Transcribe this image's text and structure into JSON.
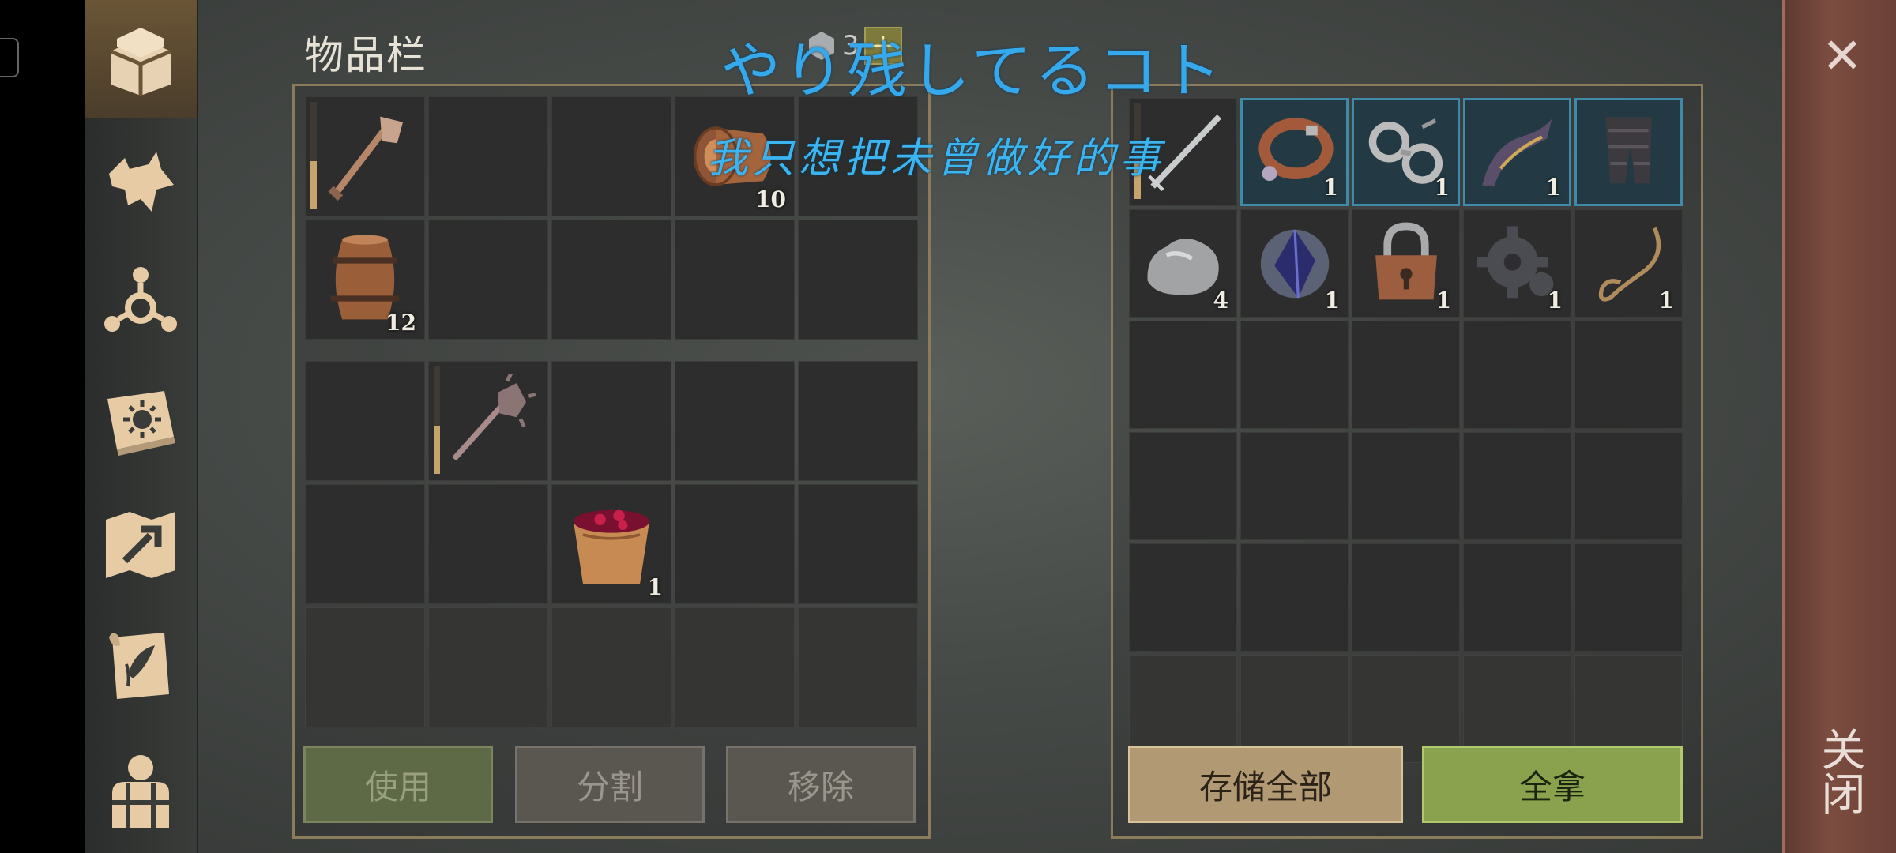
{
  "header": {
    "title": "物品栏",
    "weight_value": "3",
    "add_label": "+"
  },
  "overlay": {
    "line1": "やり残してるコト",
    "line2": "我只想把未曾做好的事"
  },
  "sidebar": {
    "items": [
      {
        "icon": "treasure-chest-icon",
        "active": true
      },
      {
        "icon": "wolf-head-icon"
      },
      {
        "icon": "skills-icon"
      },
      {
        "icon": "sun-book-icon"
      },
      {
        "icon": "crafting-map-icon"
      },
      {
        "icon": "quest-scroll-icon"
      },
      {
        "icon": "character-gear-icon"
      }
    ]
  },
  "inventory": {
    "top": [
      {
        "icon": "shovel-icon",
        "durability": 0.45
      },
      {},
      {},
      {
        "icon": "log-icon",
        "qty": "10"
      },
      {},
      {
        "icon": "barrel-icon",
        "qty": "12"
      },
      {},
      {},
      {},
      {}
    ],
    "bottom": [
      {},
      {
        "icon": "mace-icon",
        "durability": 0.45
      },
      {},
      {},
      {},
      {},
      {},
      {
        "icon": "berry-bucket-icon",
        "qty": "1"
      },
      {},
      {},
      {
        "fade": true
      },
      {
        "fade": true
      },
      {
        "fade": true
      },
      {
        "fade": true
      },
      {
        "fade": true
      }
    ]
  },
  "storage": {
    "cells": [
      {
        "icon": "sword-icon",
        "durability": 0.4
      },
      {
        "icon": "collar-icon",
        "qty": "1",
        "equipped": true
      },
      {
        "icon": "shackles-icon",
        "qty": "1",
        "equipped": true
      },
      {
        "icon": "ornate-bow-part-icon",
        "qty": "1",
        "equipped": true
      },
      {
        "icon": "chainmail-leggings-icon",
        "equipped": true
      },
      {
        "icon": "stone-icon",
        "qty": "4"
      },
      {
        "icon": "crystal-icon",
        "qty": "1"
      },
      {
        "icon": "padlock-icon",
        "qty": "1"
      },
      {
        "icon": "gear-cog-icon",
        "qty": "1"
      },
      {
        "icon": "rope-icon",
        "qty": "1"
      },
      {},
      {},
      {},
      {},
      {},
      {},
      {},
      {},
      {},
      {},
      {},
      {},
      {},
      {},
      {},
      {
        "fade": true
      },
      {
        "fade": true
      },
      {
        "fade": true
      },
      {
        "fade": true
      },
      {
        "fade": true
      }
    ]
  },
  "buttons": {
    "use": "使用",
    "split": "分割",
    "remove": "移除",
    "store_all": "存储全部",
    "take_all": "全拿"
  },
  "close": {
    "x": "✕",
    "label": "关闭"
  },
  "colors": {
    "equipped_border": "#3e8aa8",
    "take_all_green": "#8aa24d",
    "store_all_tan": "#b19a73",
    "close_panel": "#7c4c40"
  }
}
